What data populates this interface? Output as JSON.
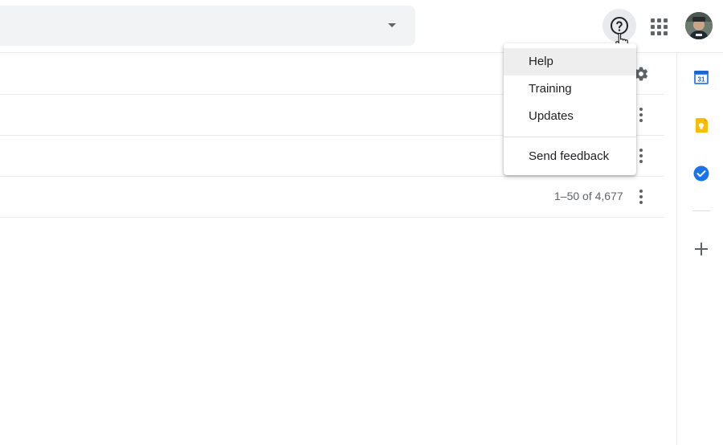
{
  "header": {
    "search": {
      "placeholder": ""
    },
    "help_icon": "help-circle-icon",
    "apps_icon": "apps-grid-icon",
    "avatar": "user-avatar"
  },
  "list": {
    "pagination": "1–50 of 4,677"
  },
  "help_menu": {
    "items": [
      {
        "label": "Help",
        "highlighted": true
      },
      {
        "label": "Training"
      },
      {
        "label": "Updates"
      },
      {
        "label": "Send feedback"
      }
    ]
  },
  "side_panel": {
    "apps": [
      {
        "name": "calendar-icon",
        "label": "31",
        "color": "#4285f4"
      },
      {
        "name": "keep-icon",
        "color": "#fbbc04"
      },
      {
        "name": "tasks-icon",
        "color": "#1a73e8"
      }
    ],
    "add_icon": "plus-icon"
  },
  "colors": {
    "icon_gray": "#5f6368",
    "divider": "#e8eaed"
  }
}
